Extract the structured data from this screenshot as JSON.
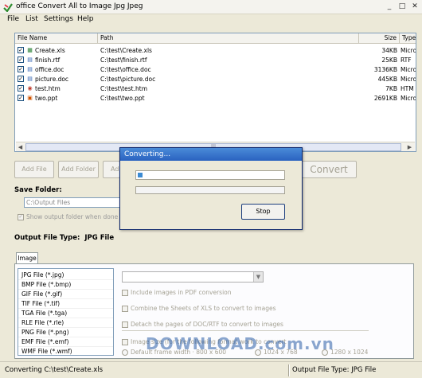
{
  "app": {
    "title": "office Convert All to Image Jpg Jpeg"
  },
  "menu": [
    "File",
    "List",
    "Settings",
    "Help"
  ],
  "filelist": {
    "columns": [
      "File Name",
      "Path",
      "Size",
      "Type"
    ],
    "rows": [
      {
        "name": "Create.xls",
        "path": "C:\\test\\Create.xls",
        "size": "34KB",
        "type": "Micro"
      },
      {
        "name": "finish.rtf",
        "path": "C:\\test\\finish.rtf",
        "size": "25KB",
        "type": "RTF"
      },
      {
        "name": "office.doc",
        "path": "C:\\test\\office.doc",
        "size": "3136KB",
        "type": "Micro"
      },
      {
        "name": "picture.doc",
        "path": "C:\\test\\picture.doc",
        "size": "445KB",
        "type": "Micro"
      },
      {
        "name": "test.htm",
        "path": "C:\\test\\test.htm",
        "size": "7KB",
        "type": "HTM"
      },
      {
        "name": "two.ppt",
        "path": "C:\\test\\two.ppt",
        "size": "2691KB",
        "type": "Micro"
      }
    ]
  },
  "buttons": {
    "add_file": "Add File",
    "add_folder": "Add Folder",
    "add_partial": "Ad",
    "convert": "Convert"
  },
  "save": {
    "title": "Save Folder:",
    "path": "C:\\Output Files",
    "show_label": "Show output folder when done"
  },
  "output_type": {
    "label": "Output File Type:",
    "value": "JPG File"
  },
  "tabs": [
    "Image"
  ],
  "formats": [
    "JPG File  (*.jpg)",
    "BMP File  (*.bmp)",
    "GIF File  (*.gif)",
    "TIF File  (*.tif)",
    "TGA File  (*.tga)",
    "RLE File  (*.rle)",
    "PNG File  (*.png)",
    "EMF File  (*.emf)",
    "WMF File  (*.wmf)"
  ],
  "options": {
    "opt1": "Include images in PDF conversion",
    "opt2": "Combine the Sheets of XLS to convert to images",
    "opt3": "Detach the pages of DOC/RTF to convert to images",
    "opt4": "Image size (for the following format work to convert",
    "r1": "Default frame width  ·  800 x 600",
    "r2": "1024 x 768",
    "r3": "1280 x 1024"
  },
  "dialog": {
    "title": "Converting...",
    "stop": "Stop",
    "progress": 0.03
  },
  "status": {
    "left": "Converting  C:\\test\\Create.xls",
    "right": "Output File Type:  JPG File"
  },
  "watermark": "DOWNLOAD.com.vn"
}
